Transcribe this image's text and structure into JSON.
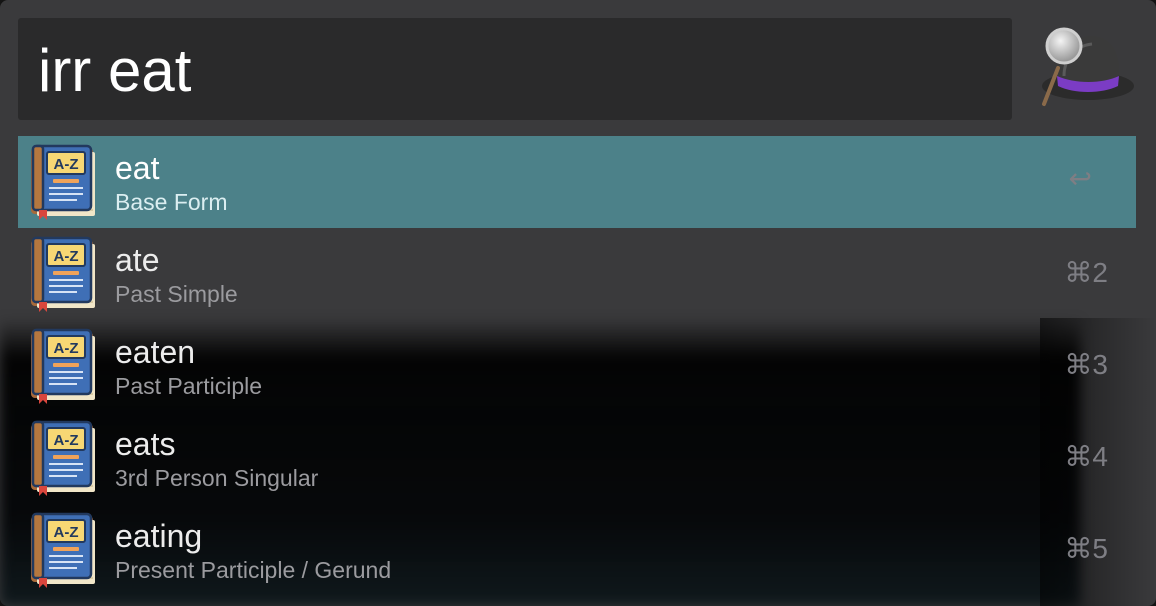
{
  "search": {
    "query": "irr eat"
  },
  "results": [
    {
      "title": "eat",
      "subtitle": "Base Form",
      "shortcut": "↩",
      "selected": true
    },
    {
      "title": "ate",
      "subtitle": "Past Simple",
      "shortcut": "⌘2",
      "selected": false
    },
    {
      "title": "eaten",
      "subtitle": "Past Participle",
      "shortcut": "⌘3",
      "selected": false
    },
    {
      "title": "eats",
      "subtitle": "3rd Person Singular",
      "shortcut": "⌘4",
      "selected": false
    },
    {
      "title": "eating",
      "subtitle": "Present Participle / Gerund",
      "shortcut": "⌘5",
      "selected": false
    }
  ],
  "icon": {
    "name": "dictionary-book-icon",
    "label": "A-Z"
  },
  "colors": {
    "window_bg": "#3a3a3c",
    "search_bg": "#2a2a2b",
    "selected_row": "#4c8189",
    "hat_band": "#7b3cc4"
  }
}
